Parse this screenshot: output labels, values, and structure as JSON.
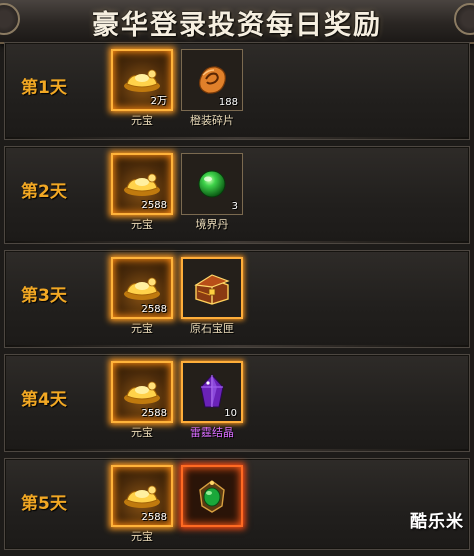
{
  "title": "豪华登录投资每日奖励",
  "rows": [
    {
      "day": "第1天",
      "items": [
        {
          "name": "元宝",
          "count": "2万",
          "icon": "gold-ingot-icon"
        },
        {
          "name": "橙装碎片",
          "count": "188",
          "icon": "orange-shard-icon"
        }
      ]
    },
    {
      "day": "第2天",
      "items": [
        {
          "name": "元宝",
          "count": "2588",
          "icon": "gold-ingot-icon"
        },
        {
          "name": "境界丹",
          "count": "3",
          "icon": "green-orb-icon"
        }
      ]
    },
    {
      "day": "第3天",
      "items": [
        {
          "name": "元宝",
          "count": "2588",
          "icon": "gold-ingot-icon"
        },
        {
          "name": "原石宝匣",
          "count": "",
          "icon": "treasure-chest-icon"
        }
      ]
    },
    {
      "day": "第4天",
      "items": [
        {
          "name": "元宝",
          "count": "2588",
          "icon": "gold-ingot-icon"
        },
        {
          "name": "雷霆结晶",
          "count": "10",
          "icon": "purple-crystal-icon"
        }
      ]
    },
    {
      "day": "第5天",
      "items": [
        {
          "name": "元宝",
          "count": "2588",
          "icon": "gold-ingot-icon"
        },
        {
          "name": "",
          "count": "",
          "icon": "green-amulet-icon"
        }
      ]
    }
  ],
  "watermark": "酷乐米",
  "colors": {
    "day_label": "#f2a824",
    "rare_item_name": "#d86cff",
    "gold_glow": "#ff9a1e",
    "orange_glow": "#ff4b10"
  }
}
